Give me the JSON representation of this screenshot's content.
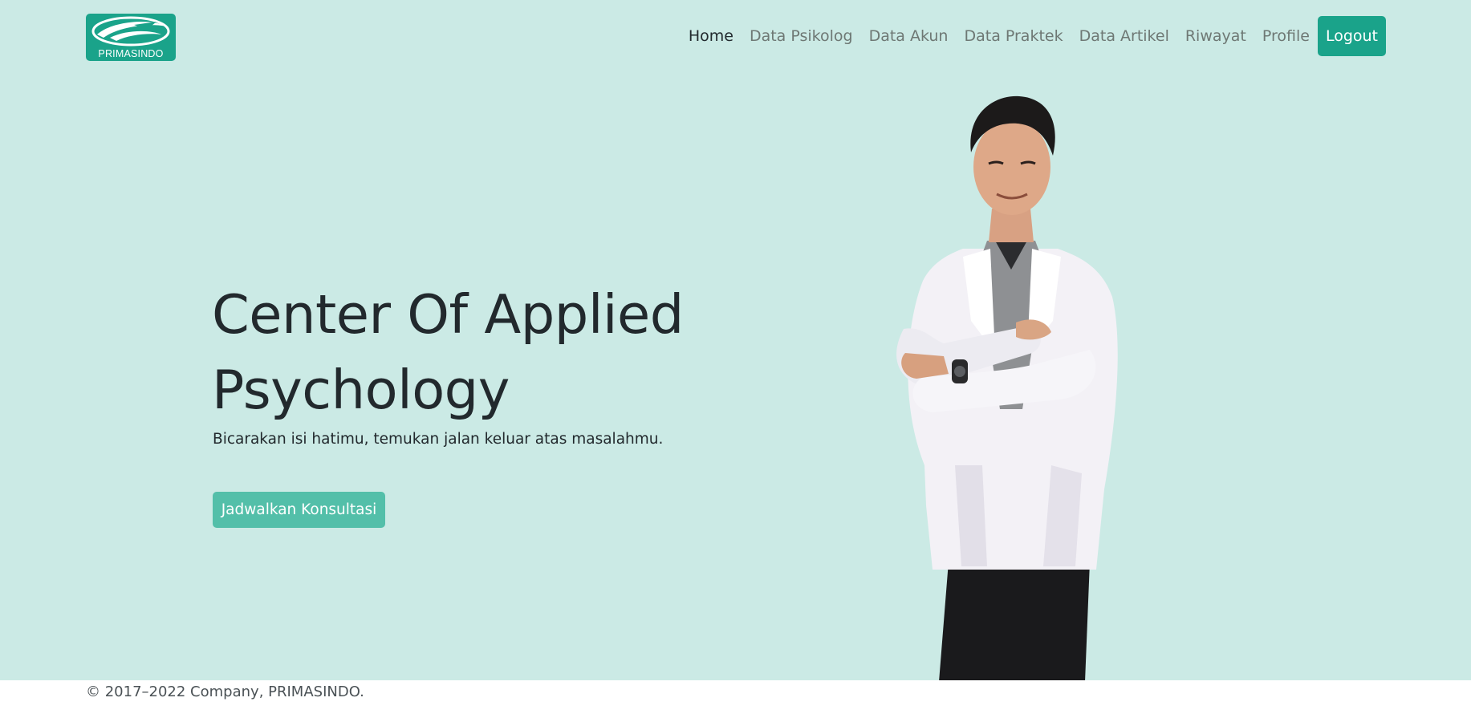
{
  "brand": {
    "name": "PRIMASINDO",
    "color": "#1aa38a"
  },
  "nav": {
    "items": [
      {
        "label": "Home",
        "active": true
      },
      {
        "label": "Data Psikolog",
        "active": false
      },
      {
        "label": "Data Akun",
        "active": false
      },
      {
        "label": "Data Praktek",
        "active": false
      },
      {
        "label": "Data Artikel",
        "active": false
      },
      {
        "label": "Riwayat",
        "active": false
      },
      {
        "label": "Profile",
        "active": false
      }
    ],
    "logout_label": "Logout"
  },
  "hero": {
    "title": "Center Of Applied Psychology",
    "subtitle": "Bicarakan isi hatimu, temukan jalan keluar atas masalahmu.",
    "cta_label": "Jadwalkan Konsultasi",
    "background": "#cbeae5",
    "cta_color": "#53bfa9"
  },
  "footer": {
    "text": "© 2017–2022 Company, PRIMASINDO."
  }
}
